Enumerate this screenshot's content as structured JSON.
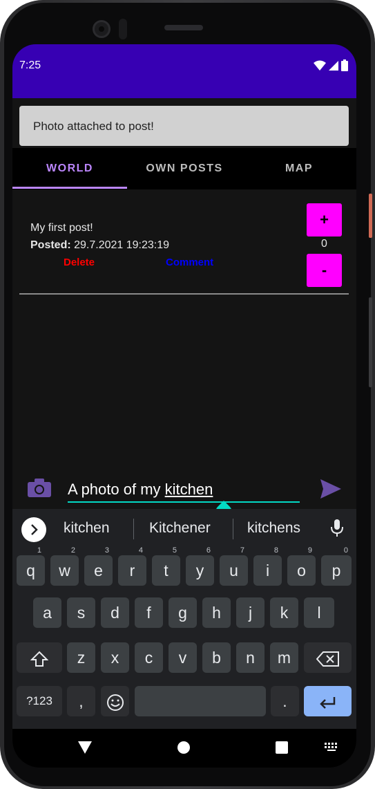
{
  "status_bar": {
    "time": "7:25"
  },
  "toast": {
    "message": "Photo attached to post!"
  },
  "tabs": [
    {
      "label": "WORLD",
      "active": true
    },
    {
      "label": "OWN POSTS",
      "active": false
    },
    {
      "label": "MAP",
      "active": false
    }
  ],
  "post": {
    "text": "My first post!",
    "posted_label": "Posted:",
    "posted_date": "29.7.2021 19:23:19",
    "delete_label": "Delete",
    "comment_label": "Comment",
    "upvote_label": "+",
    "downvote_label": "-",
    "vote_count": "0"
  },
  "composer": {
    "text_prefix": "A photo of my ",
    "text_underlined": "kitchen"
  },
  "keyboard": {
    "suggestions": [
      "kitchen",
      "Kitchener",
      "kitchens"
    ],
    "row1": [
      {
        "k": "q",
        "h": "1"
      },
      {
        "k": "w",
        "h": "2"
      },
      {
        "k": "e",
        "h": "3"
      },
      {
        "k": "r",
        "h": "4"
      },
      {
        "k": "t",
        "h": "5"
      },
      {
        "k": "y",
        "h": "6"
      },
      {
        "k": "u",
        "h": "7"
      },
      {
        "k": "i",
        "h": "8"
      },
      {
        "k": "o",
        "h": "9"
      },
      {
        "k": "p",
        "h": "0"
      }
    ],
    "row2": [
      "a",
      "s",
      "d",
      "f",
      "g",
      "h",
      "j",
      "k",
      "l"
    ],
    "row3": [
      "z",
      "x",
      "c",
      "v",
      "b",
      "n",
      "m"
    ],
    "symbols_label": "?123",
    "comma_label": ",",
    "period_label": "."
  },
  "colors": {
    "status_bar": "#3700b3",
    "accent": "#bb86fc",
    "vote_button": "#ff00ff",
    "delete": "#ff0000",
    "comment": "#0000ff",
    "input_accent": "#03dac5",
    "enter_key": "#8ab4f8"
  },
  "icons": {
    "camera": "camera-icon",
    "send": "send-icon",
    "mic": "mic-icon",
    "shift": "shift-icon",
    "backspace": "backspace-icon",
    "emoji": "emoji-icon",
    "enter": "enter-icon"
  }
}
